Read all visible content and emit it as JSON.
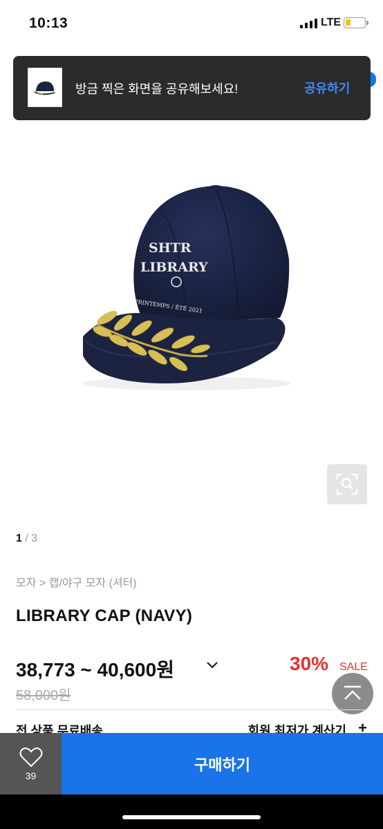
{
  "status_bar": {
    "time": "10:13",
    "network": "LTE",
    "signal_icon": "signal-bars-icon",
    "battery_icon": "battery-icon"
  },
  "share_toast": {
    "message": "방금 찍은 화면을 공유해보세요!",
    "button": "공유하기"
  },
  "product": {
    "image_pager": {
      "current": "1",
      "separator": " / ",
      "total": "3"
    },
    "breadcrumb": "모자 > 캡/야구 모자 (셔터)",
    "title": "LIBRARY CAP (NAVY)",
    "price_range": "38,773 ~ 40,600원",
    "discount": "30%",
    "sale_label": "SALE",
    "original_price": "58,000원",
    "cap_text": {
      "line1": "SHTR",
      "line2": "LIBRARY",
      "line3": "PRINTEMPS / ÉTÉ 2021"
    }
  },
  "shipping": {
    "left": "전 상품 무료배송",
    "right": "회원 최저가 계산기"
  },
  "bottom_bar": {
    "like_count": "39",
    "buy_label": "구매하기"
  },
  "colors": {
    "accent": "#1a73e8",
    "sale": "#e5312d",
    "toast_bg": "#2b2b2b",
    "cap_navy": "#1b2340",
    "leaf_gold": "#d8bf55"
  }
}
